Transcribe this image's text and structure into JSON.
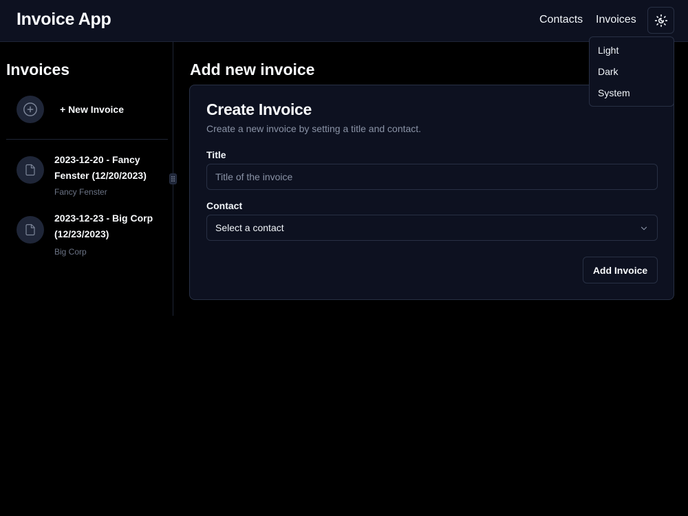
{
  "header": {
    "app_title": "Invoice App",
    "nav": {
      "contacts": "Contacts",
      "invoices": "Invoices"
    },
    "theme_toggle_icon": "sun-moon-icon",
    "theme_menu": {
      "items": [
        "Light",
        "Dark",
        "System"
      ]
    }
  },
  "sidebar": {
    "title": "Invoices",
    "new_invoice_label": "+ New Invoice",
    "new_invoice_icon": "plus-circle-icon",
    "invoices": [
      {
        "name": "2023-12-20 - Fancy Fenster (12/20/2023)",
        "contact": "Fancy Fenster",
        "icon": "file-icon"
      },
      {
        "name": "2023-12-23 - Big Corp (12/23/2023)",
        "contact": "Big Corp",
        "icon": "file-icon"
      }
    ]
  },
  "main": {
    "title": "Add new invoice",
    "card": {
      "title": "Create Invoice",
      "description": "Create a new invoice by setting a title and contact.",
      "title_label": "Title",
      "title_placeholder": "Title of the invoice",
      "title_value": "",
      "contact_label": "Contact",
      "contact_value": "Select a contact",
      "submit_label": "Add Invoice"
    }
  },
  "colors": {
    "background": "#000000",
    "surface": "#0d1120",
    "border": "#283044",
    "text": "#f8fafc",
    "muted_text": "#8a93a6"
  }
}
